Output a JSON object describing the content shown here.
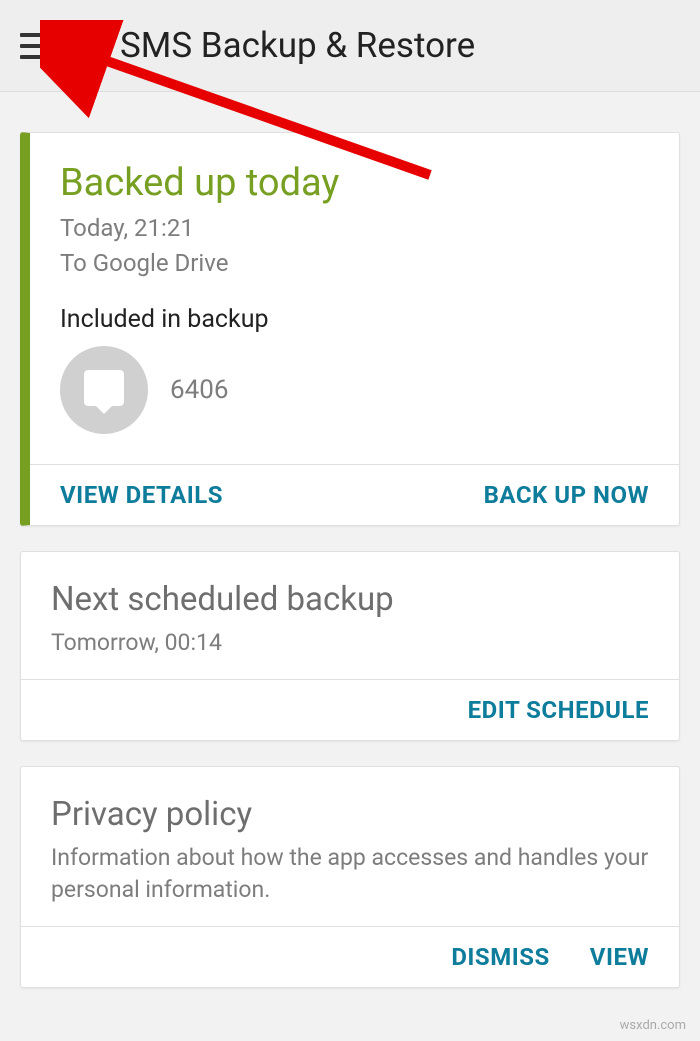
{
  "appbar": {
    "title": "SMS Backup & Restore"
  },
  "cards": {
    "backup": {
      "title": "Backed up today",
      "time": "Today, 21:21",
      "destination": "To Google Drive",
      "included_label": "Included in backup",
      "count": "6406",
      "view_details": "VIEW DETAILS",
      "backup_now": "BACK UP NOW"
    },
    "schedule": {
      "title": "Next scheduled backup",
      "time": "Tomorrow, 00:14",
      "edit": "EDIT SCHEDULE"
    },
    "privacy": {
      "title": "Privacy policy",
      "desc": "Information about how the app accesses and handles your personal information.",
      "dismiss": "DISMISS",
      "view": "VIEW"
    }
  },
  "watermark": "wsxdn.com"
}
